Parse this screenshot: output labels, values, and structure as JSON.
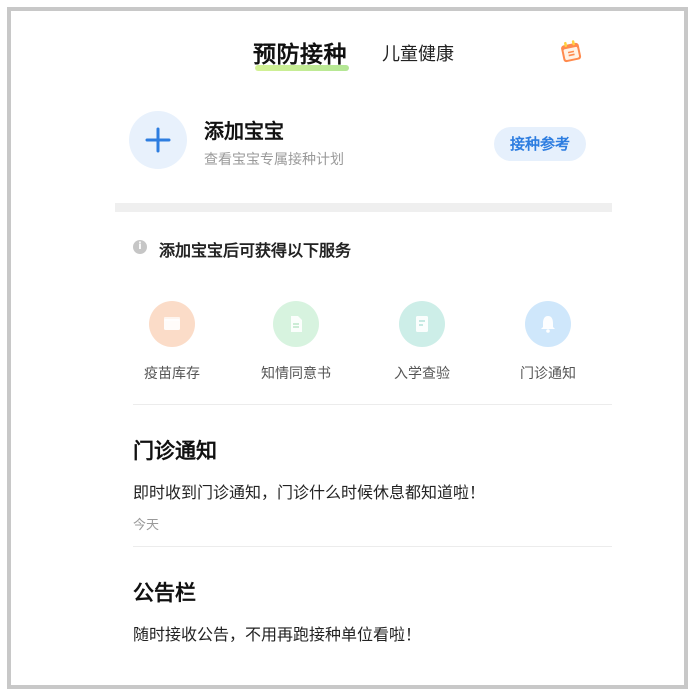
{
  "header": {
    "tab_active": "预防接种",
    "tab_other": "儿童健康"
  },
  "add_baby": {
    "title": "添加宝宝",
    "subtitle": "查看宝宝专属接种计划",
    "ref_button": "接种参考"
  },
  "info": {
    "text": "添加宝宝后可获得以下服务"
  },
  "services": [
    {
      "label": "疫苗库存",
      "icon": "vaccine-stock-icon",
      "color": "#fbdcc8"
    },
    {
      "label": "知情同意书",
      "icon": "consent-document-icon",
      "color": "#d7f3df"
    },
    {
      "label": "入学查验",
      "icon": "school-check-icon",
      "color": "#cdeee8"
    },
    {
      "label": "门诊通知",
      "icon": "bell-icon",
      "color": "#cfe7fb"
    }
  ],
  "clinic": {
    "title": "门诊通知",
    "text": "即时收到门诊通知，门诊什么时候休息都知道啦！",
    "time": "今天"
  },
  "bulletin": {
    "title": "公告栏",
    "text": "随时接收公告，不用再跑接种单位看啦！"
  },
  "colors": {
    "accent": "#2d7de0",
    "tab_underline": "#b3e87a"
  }
}
